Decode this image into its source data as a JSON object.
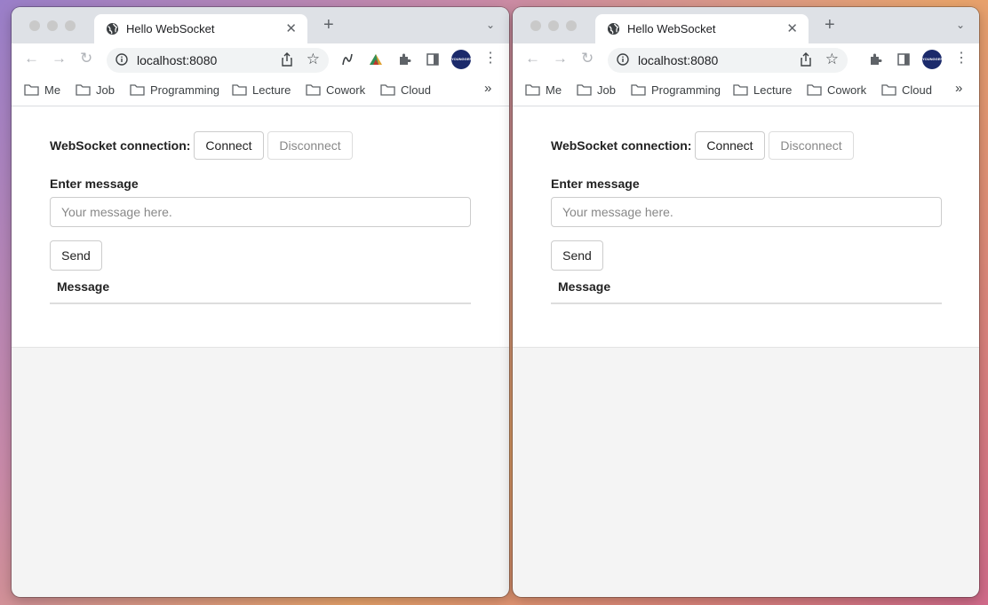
{
  "windows": [
    {
      "tab_title": "Hello WebSocket",
      "url": "localhost:8080",
      "bookmarks": [
        "Me",
        "Job",
        "Programming",
        "Lecture",
        "Cowork",
        "Cloud"
      ],
      "more_bookmarks": "»",
      "avatar_text": "YOUNGGER",
      "connection_label": "WebSocket connection:",
      "connect_label": "Connect",
      "disconnect_label": "Disconnect",
      "message_label": "Enter message",
      "message_placeholder": "Your message here.",
      "send_label": "Send",
      "table_header": "Message"
    },
    {
      "tab_title": "Hello WebSocket",
      "url": "localhost:8080",
      "bookmarks": [
        "Me",
        "Job",
        "Programming",
        "Lecture",
        "Cowork",
        "Cloud"
      ],
      "more_bookmarks": "»",
      "avatar_text": "YOUNGGER",
      "connection_label": "WebSocket connection:",
      "connect_label": "Connect",
      "disconnect_label": "Disconnect",
      "message_label": "Enter message",
      "message_placeholder": "Your message here.",
      "send_label": "Send",
      "table_header": "Message"
    }
  ],
  "icons": {
    "tab_close": "close-icon",
    "new_tab": "plus-icon",
    "tab_menu": "chevron-down-icon",
    "back": "arrow-left-icon",
    "forward": "arrow-right-icon",
    "reload": "reload-icon",
    "site_info": "info-icon",
    "share": "share-icon",
    "bookmark": "star-icon",
    "extensions": "puzzle-icon",
    "side_panel": "side-panel-icon",
    "menu": "kebab-menu-icon"
  },
  "colors": {
    "accent_avatar": "#1b2a6b",
    "tab_strip": "#dee1e6",
    "content_background": "#f4f4f4"
  }
}
